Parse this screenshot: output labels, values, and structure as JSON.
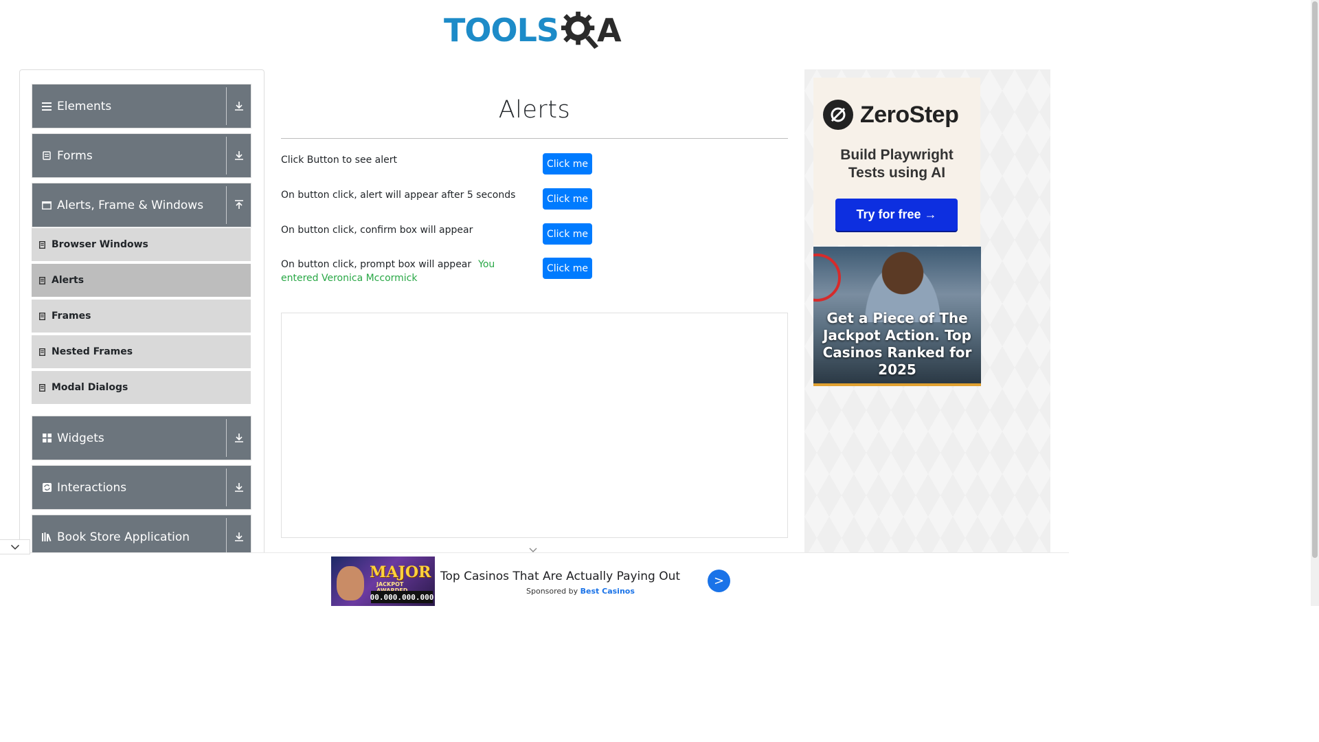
{
  "header": {
    "logo_text_main": "TOOLS",
    "logo_text_end": "A"
  },
  "sidebar": {
    "groups": [
      {
        "label": "Elements",
        "icon": "hamburger-icon",
        "expanded": false
      },
      {
        "label": "Forms",
        "icon": "form-icon",
        "expanded": false
      },
      {
        "label": "Alerts, Frame & Windows",
        "icon": "window-icon",
        "expanded": true
      },
      {
        "label": "Widgets",
        "icon": "widgets-icon",
        "expanded": false
      },
      {
        "label": "Interactions",
        "icon": "interactions-icon",
        "expanded": false
      },
      {
        "label": "Book Store Application",
        "icon": "books-icon",
        "expanded": false
      }
    ],
    "sub_items": [
      {
        "label": "Browser Windows",
        "active": false
      },
      {
        "label": "Alerts",
        "active": true
      },
      {
        "label": "Frames",
        "active": false
      },
      {
        "label": "Nested Frames",
        "active": false
      },
      {
        "label": "Modal Dialogs",
        "active": false
      }
    ]
  },
  "main": {
    "title": "Alerts",
    "rows": [
      {
        "label": "Click Button to see alert",
        "button": "Click me"
      },
      {
        "label": "On button click, alert will appear after 5 seconds",
        "button": "Click me"
      },
      {
        "label": "On button click, confirm box will appear",
        "button": "Click me"
      },
      {
        "label": "On button click, prompt box will appear",
        "result": "You entered Veronica Mccormick",
        "button": "Click me"
      }
    ]
  },
  "right_ad": {
    "brand": "ZeroStep",
    "tagline_1": "Build Playwright",
    "tagline_2": "Tests using AI",
    "cta": "Try for free →",
    "casino_text": "Get a Piece of The Jackpot Action. Top Casinos Ranked for 2025"
  },
  "bottom_ad": {
    "image_word": "MAJOR",
    "image_sub": "JACKPOT AWARDED",
    "image_amount": "00.000.000.000",
    "headline": "Top Casinos That Are Actually Paying Out",
    "sponsored_by": "Sponsored by",
    "sponsor": "Best Casinos",
    "go": ">"
  },
  "colors": {
    "group_bg": "#6c757d",
    "sub_bg": "#d9d9d9",
    "sub_active_bg": "#bdbdbd",
    "button_blue": "#007bff",
    "result_green": "#28a745",
    "logo_blue": "#1d8bc8"
  }
}
